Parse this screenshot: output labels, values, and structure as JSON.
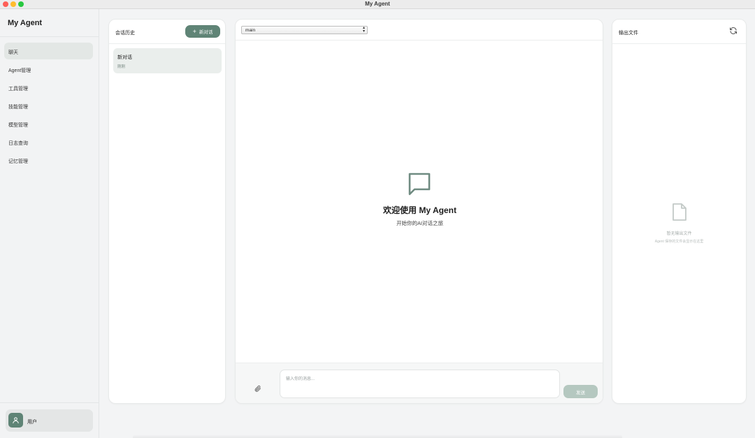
{
  "window": {
    "title": "My Agent"
  },
  "nav": {
    "brand": "My Agent",
    "items": [
      {
        "label": "聊天",
        "active": true
      },
      {
        "label": "Agent管理",
        "active": false
      },
      {
        "label": "工具管理",
        "active": false
      },
      {
        "label": "技能管理",
        "active": false
      },
      {
        "label": "模型管理",
        "active": false
      },
      {
        "label": "日志查询",
        "active": false
      },
      {
        "label": "记忆管理",
        "active": false
      }
    ],
    "user": {
      "name": "用户",
      "icon": "user-icon"
    }
  },
  "history": {
    "title": "会话历史",
    "new_button": "新对话",
    "sessions": [
      {
        "title": "新对话",
        "time": "刚刚"
      }
    ]
  },
  "chat": {
    "model_selected": "main",
    "welcome_title": "欢迎使用 My Agent",
    "welcome_subtitle": "开始你的AI对话之旅",
    "input_placeholder": "输入你的消息...",
    "send_label": "发送"
  },
  "output": {
    "title": "输出文件",
    "empty_title": "暂无输出文件",
    "empty_subtitle": "Agent 保存的文件会显示在这里"
  },
  "colors": {
    "accent": "#5f8476",
    "accent_disabled": "#b5c8c0",
    "active_nav": "#e3e7e5"
  }
}
